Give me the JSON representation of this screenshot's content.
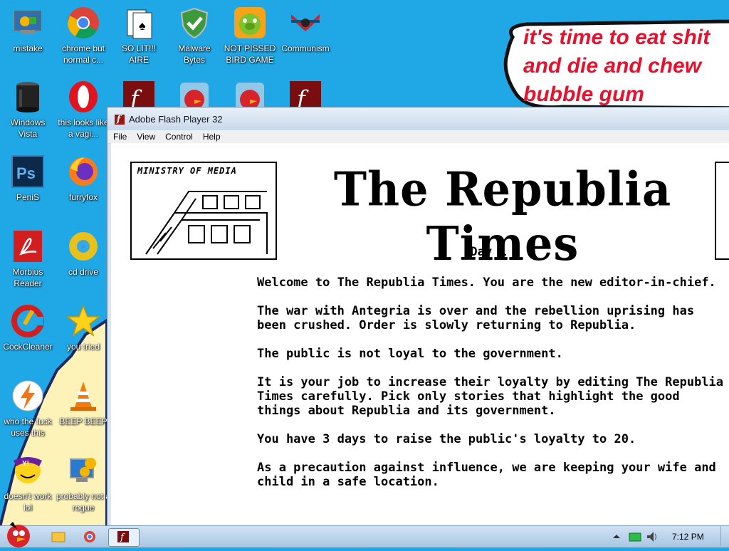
{
  "desktop": {
    "icons": [
      {
        "label": "mistake"
      },
      {
        "label": "chrome but normal c..."
      },
      {
        "label": "SO LIT!!! AIRE"
      },
      {
        "label": "Malware Bytes"
      },
      {
        "label": "NOT PISSED BIRD GAME"
      },
      {
        "label": "Communism"
      },
      {
        "label": "Windows Vista"
      },
      {
        "label": "this looks like a vagi..."
      },
      {
        "label": "PeniS"
      },
      {
        "label": "furryfox"
      },
      {
        "label": "Morbius Reader"
      },
      {
        "label": "cd drive"
      },
      {
        "label": "CockCleaner"
      },
      {
        "label": "you tried"
      },
      {
        "label": "who the fuck uses this"
      },
      {
        "label": "BEEP BEEP"
      },
      {
        "label": "doesn't work lol"
      },
      {
        "label": "probably not a rogue"
      }
    ],
    "bubble_text": "it's time to eat shit\nand die and chew\nbubble gum"
  },
  "window": {
    "title": "Adobe Flash Player 32",
    "menu": [
      "File",
      "View",
      "Control",
      "Help"
    ]
  },
  "game": {
    "ministry_label": "MINISTRY OF MEDIA",
    "masthead": "The Republia Times",
    "day": "Day 1",
    "paragraphs": [
      "Welcome to The Republia Times. You are the new editor-in-chief.",
      "The war with Antegria is over and the rebellion uprising has been crushed. Order is slowly returning to Republia.",
      "The public is not loyal to the government.",
      "It is your job to increase their loyalty by editing The Republia Times carefully. Pick only stories that highlight the good things about Republia and its government.",
      "You have 3 days to raise the public's loyalty to 20.",
      "As a precaution against influence, we are keeping your wife and child in a safe location."
    ]
  },
  "taskbar": {
    "clock": "7:12 PM"
  },
  "colors": {
    "wallpaper": "#1fa7e6",
    "bubble_text": "#e8112d",
    "sand": "#fdf3b8"
  }
}
